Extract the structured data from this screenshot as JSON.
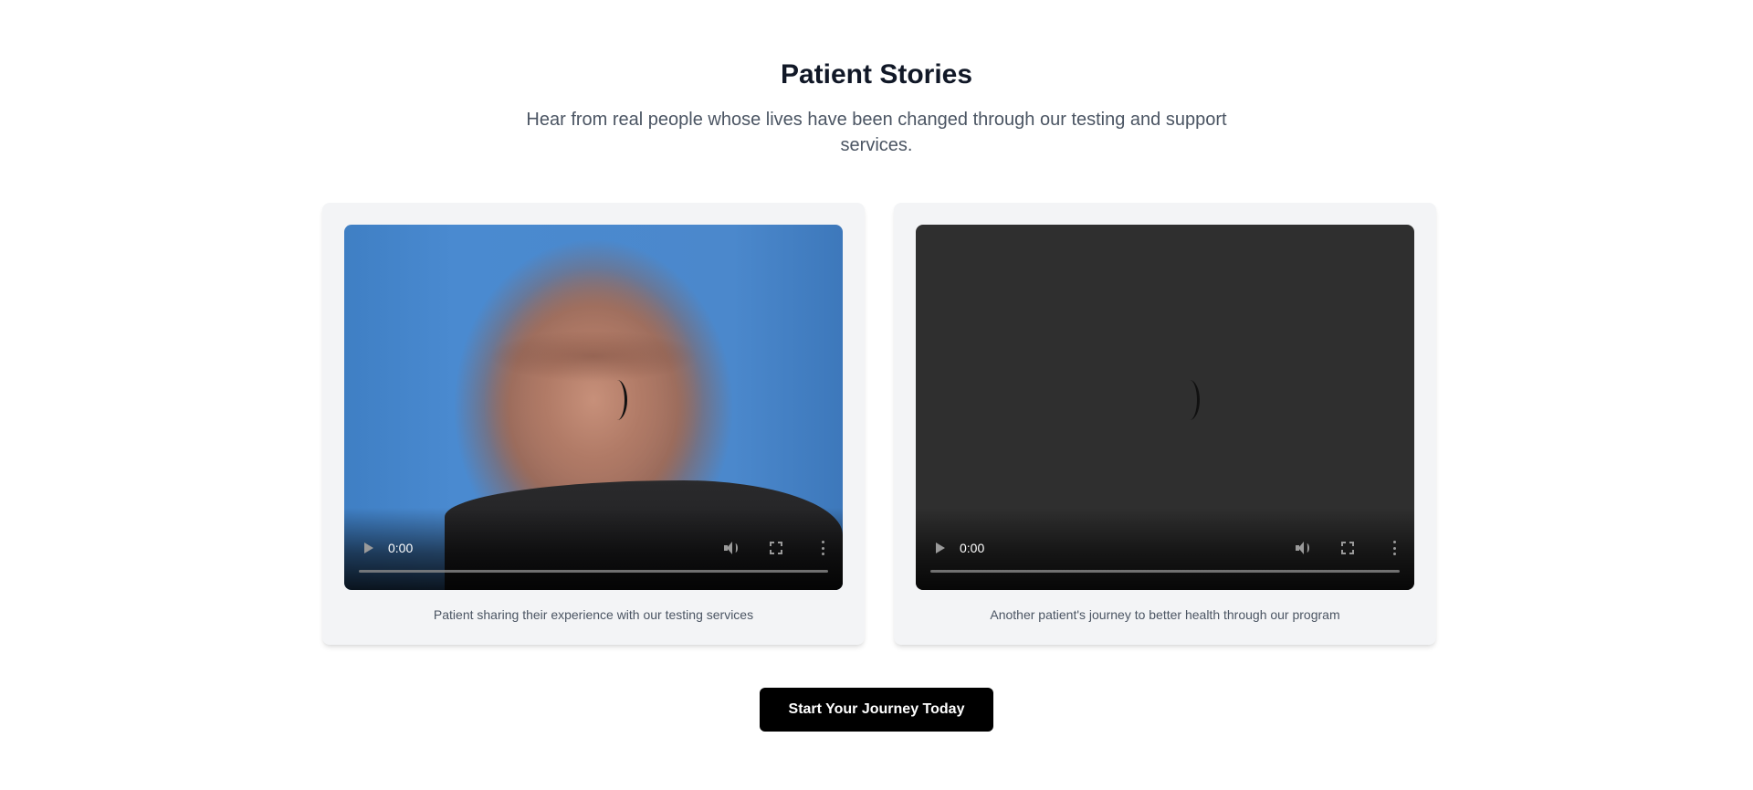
{
  "section": {
    "title": "Patient Stories",
    "subtitle": "Hear from real people whose lives have been changed through our testing and support services."
  },
  "videos": [
    {
      "current_time": "0:00",
      "caption": "Patient sharing their experience with our testing services",
      "poster": "man-portrait-blue-wall"
    },
    {
      "current_time": "0:00",
      "caption": "Another patient's journey to better health through our program",
      "poster": "none"
    }
  ],
  "cta": {
    "label": "Start Your Journey Today"
  },
  "colors": {
    "background": "#ffffff",
    "card_background": "#f3f4f6",
    "title": "#111827",
    "subtitle": "#4b5563",
    "button_background": "#000000",
    "button_text": "#ffffff"
  }
}
